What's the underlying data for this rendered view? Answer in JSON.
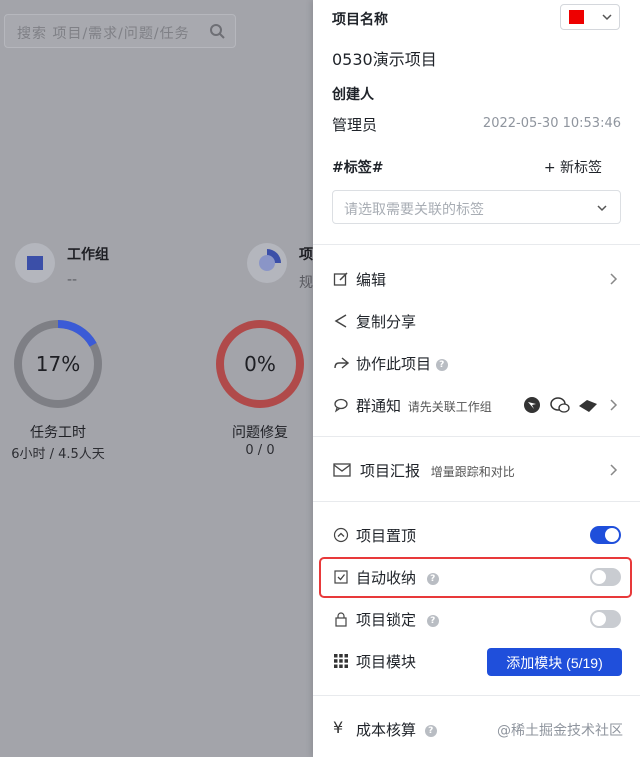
{
  "background": {
    "search_placeholder": "搜索 项目/需求/问题/任务",
    "stats": [
      {
        "label": "工作组",
        "sub": "--"
      },
      {
        "label": "项",
        "sub": "规"
      }
    ],
    "rings": [
      {
        "percent_text": "17%",
        "percent": 17,
        "title": "任务工时",
        "sub": "6小时 / 4.5人天",
        "color": "#3b5bd6"
      },
      {
        "percent_text": "0%",
        "percent": 0,
        "title": "问题修复",
        "sub": "0 / 0",
        "color": "#c74545"
      }
    ]
  },
  "panel": {
    "project_name_label": "项目名称",
    "project_color": "#ee0000",
    "project_name": "0530演示项目",
    "creator_label": "创建人",
    "creator": "管理员",
    "created_at": "2022-05-30 10:53:46",
    "tags_label": "#标签#",
    "new_tag_label": "+ 新标签",
    "tag_select_placeholder": "请选取需要关联的标签",
    "menu": {
      "edit": "编辑",
      "copy_share": "复制分享",
      "collaborate": "协作此项目",
      "group_notify": "群通知",
      "group_notify_hint": "请先关联工作组",
      "report": "项目汇报",
      "report_hint": "增量跟踪和对比"
    },
    "settings": {
      "pin_label": "项目置顶",
      "pin_on": true,
      "auto_archive_label": "自动收纳",
      "auto_archive_on": false,
      "lock_label": "项目锁定",
      "lock_on": false,
      "modules_label": "项目模块",
      "add_module_button": "添加模块 (5/19)",
      "cost_label": "成本核算"
    },
    "watermark": "@稀土掘金技术社区",
    "accent_color": "#1f4fdb",
    "highlight_color": "#e8393a"
  }
}
